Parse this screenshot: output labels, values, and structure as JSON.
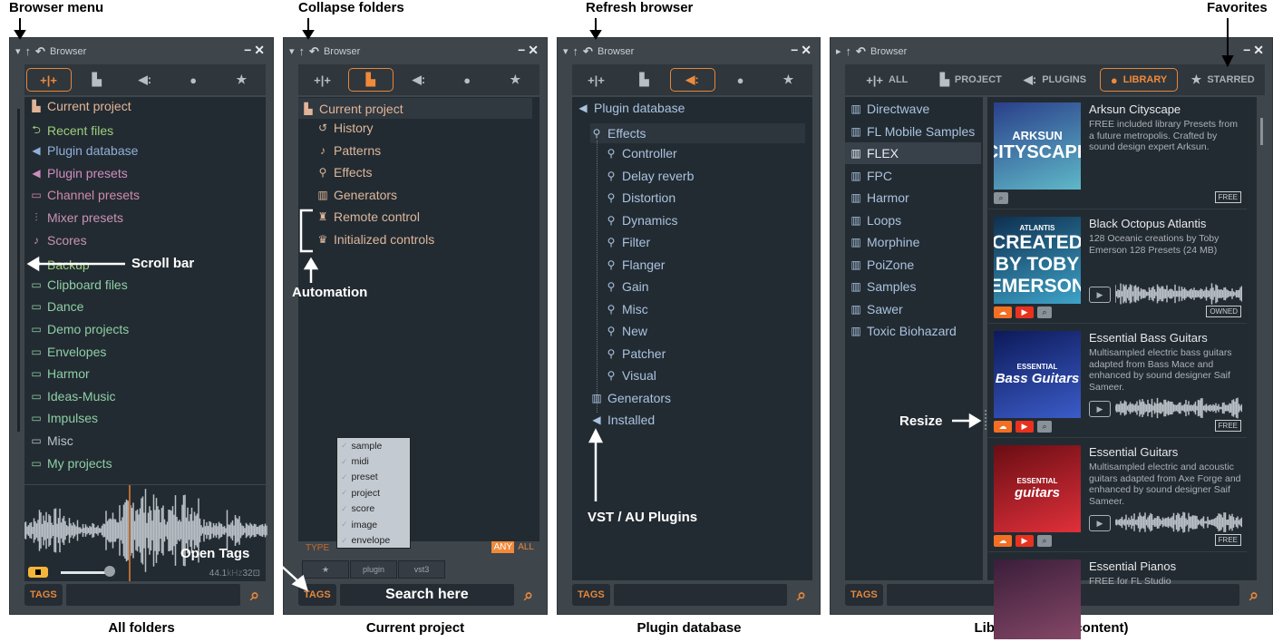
{
  "annotations": {
    "browser_menu": "Browser menu",
    "collapse_folders": "Collapse folders",
    "refresh_browser": "Refresh browser",
    "favorites": "Favorites",
    "scroll_bar": "Scroll bar",
    "automation": "Automation",
    "vst_au": "VST / AU Plugins",
    "resize": "Resize",
    "open_tags": "Open Tags",
    "search_here": "Search here"
  },
  "captions": [
    "All folders",
    "Current project",
    "Plugin database",
    "Library (Online content)"
  ],
  "window_title": "Browser",
  "tags_label": "TAGS",
  "tab_labels": [
    "ALL",
    "PROJECT",
    "PLUGINS",
    "LIBRARY",
    "STARRED"
  ],
  "accent": "#e4873d",
  "panel1": {
    "items": [
      {
        "label": "Current project",
        "color": "#e2b497",
        "icon": "▙"
      },
      {
        "label": "Recent files",
        "color": "#9ccf7c",
        "icon": "⮌"
      },
      {
        "label": "Plugin database",
        "color": "#8fb0d9",
        "icon": "◀"
      },
      {
        "label": "Plugin presets",
        "color": "#d08dbd",
        "icon": "◀"
      },
      {
        "label": "Channel presets",
        "color": "#cf8aab",
        "icon": "▭"
      },
      {
        "label": "Mixer presets",
        "color": "#c993b4",
        "icon": "⫶"
      },
      {
        "label": "Scores",
        "color": "#c993b4",
        "icon": "♪"
      },
      {
        "label": "Backup",
        "color": "#9ccf7c",
        "icon": "⮌"
      },
      {
        "label": "Clipboard files",
        "color": "#8ecfa5",
        "icon": "▭"
      },
      {
        "label": "Dance",
        "color": "#8ecfa5",
        "icon": "▭"
      },
      {
        "label": "Demo projects",
        "color": "#8ecfa5",
        "icon": "▭"
      },
      {
        "label": "Envelopes",
        "color": "#8ecfa5",
        "icon": "▭"
      },
      {
        "label": "Harmor",
        "color": "#8ecfa5",
        "icon": "▭"
      },
      {
        "label": "Ideas-Music",
        "color": "#8ecfa5",
        "icon": "▭"
      },
      {
        "label": "Impulses",
        "color": "#8ecfa5",
        "icon": "▭"
      },
      {
        "label": "Misc",
        "color": "#b8c3cc",
        "icon": "▭"
      },
      {
        "label": "My projects",
        "color": "#8ecfa5",
        "icon": "▭"
      }
    ],
    "sample_rate": "44.1",
    "sample_rate_unit": "kHz",
    "bit_depth": "32"
  },
  "panel2": {
    "header": "Current project",
    "items": [
      "History",
      "Patterns",
      "Effects",
      "Generators",
      "Remote control",
      "Initialized controls"
    ],
    "tag_types": [
      "sample",
      "midi",
      "preset",
      "project",
      "score",
      "image",
      "envelope"
    ],
    "type_label": "TYPE",
    "any_label": "ANY",
    "all_label": "ALL",
    "tag_buttons": [
      "★",
      "plugin",
      "vst3"
    ]
  },
  "panel3": {
    "root": "Plugin database",
    "effects": "Effects",
    "effect_items": [
      "Controller",
      "Delay reverb",
      "Distortion",
      "Dynamics",
      "Filter",
      "Flanger",
      "Gain",
      "Misc",
      "New",
      "Patcher",
      "Visual"
    ],
    "generators": "Generators",
    "installed": "Installed"
  },
  "panel4": {
    "libraries": [
      "Directwave",
      "FL Mobile Samples",
      "FLEX",
      "FPC",
      "Harmor",
      "Loops",
      "Morphine",
      "PoiZone",
      "Samples",
      "Sawer",
      "Toxic Biohazard"
    ],
    "selected_library": "FLEX",
    "cards": [
      {
        "title": "Arksun Cityscape",
        "desc": "FREE included library Presets from a future metropolis. Crafted by sound design expert Arksun.",
        "badge": "FREE",
        "art": [
          "ARKSUN",
          "CITYSCAPE"
        ],
        "colors": [
          "#2a3f8a",
          "#5fb8c8"
        ],
        "player": false
      },
      {
        "title": "Black Octopus Atlantis",
        "desc": "128 Oceanic creations by Toby Emerson 128 Presets (24 MB)",
        "badge": "OWNED",
        "art": [
          "ATLANTIS",
          "CREATED BY TOBY EMERSON"
        ],
        "colors": [
          "#0e2f4f",
          "#3ea3c9"
        ],
        "player": true
      },
      {
        "title": "Essential Bass Guitars",
        "desc": "Multisampled electric bass guitars adapted from Bass Mace and enhanced by sound designer Saif Sameer.",
        "badge": "FREE",
        "art": [
          "ESSENTIAL",
          "Bass Guitars"
        ],
        "colors": [
          "#0d1a5a",
          "#3b5cc8"
        ],
        "player": true
      },
      {
        "title": "Essential Guitars",
        "desc": "Multisampled electric and acoustic guitars adapted from Axe Forge and enhanced by sound designer Saif Sameer.",
        "badge": "FREE",
        "art": [
          "ESSENTIAL",
          "guitars"
        ],
        "colors": [
          "#6a0d14",
          "#e0303a"
        ],
        "player": true
      },
      {
        "title": "Essential Pianos",
        "desc": "FREE for FL Studio",
        "badge": "",
        "art": [
          "",
          ""
        ],
        "colors": [
          "#3a1e3a",
          "#8a4a6a"
        ],
        "player": false
      }
    ]
  }
}
